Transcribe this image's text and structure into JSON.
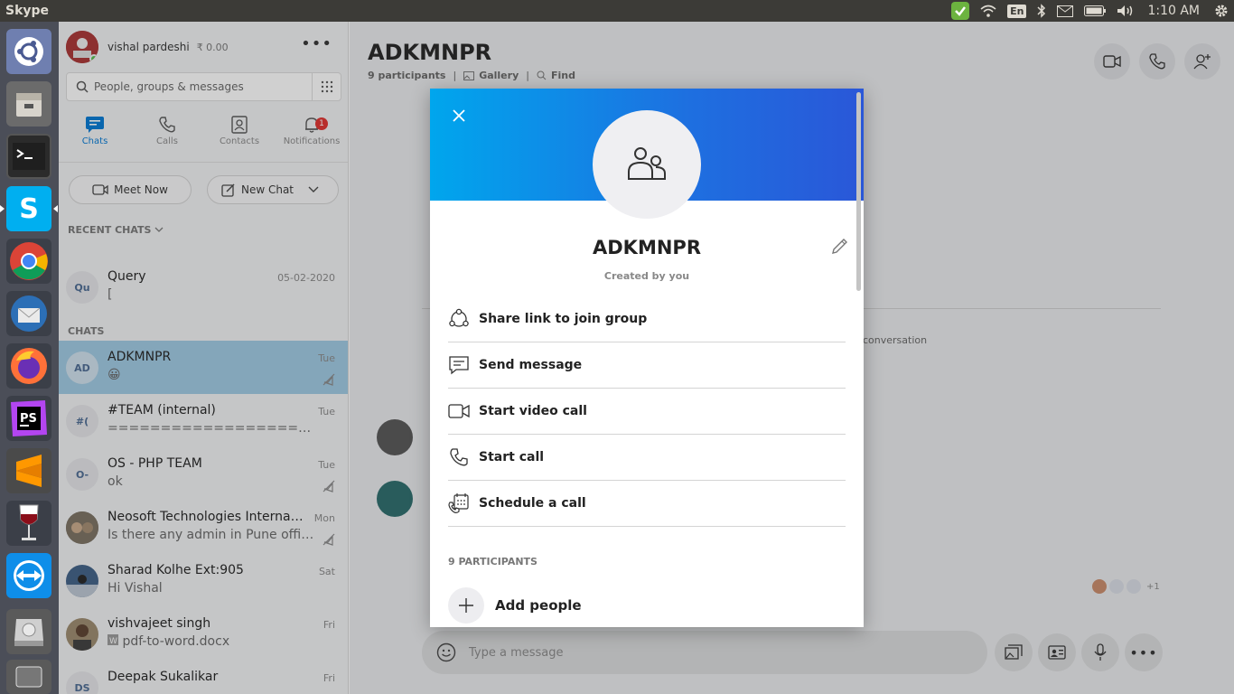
{
  "topbar": {
    "app_title": "Skype",
    "keyboard": "En",
    "clock": "1:10 AM"
  },
  "launcher": {
    "apps": [
      "ubuntu-dash-icon",
      "files-icon",
      "terminal-icon",
      "skype-icon",
      "chrome-icon",
      "thunderbird-icon",
      "firefox-icon",
      "phpstorm-icon",
      "sublime-text-icon",
      "wine-icon",
      "teamviewer-icon",
      "disk-icon",
      "drive-icon"
    ]
  },
  "profile": {
    "name": "vishal pardeshi",
    "credit": "₹ 0.00"
  },
  "search": {
    "placeholder": "People, groups & messages"
  },
  "nav": {
    "chats": "Chats",
    "calls": "Calls",
    "contacts": "Contacts",
    "notifications": "Notifications",
    "notification_count": "1"
  },
  "actions": {
    "meet_now": "Meet Now",
    "new_chat": "New Chat"
  },
  "sections": {
    "recent": "RECENT CHATS",
    "chats": "CHATS"
  },
  "recent_chats": [
    {
      "initials": "Qu",
      "name": "Query",
      "preview": "[",
      "date": "05-02-2020"
    }
  ],
  "chats": [
    {
      "initials": "AD",
      "name": "ADKMNPR",
      "preview": "😀",
      "date": "Tue"
    },
    {
      "initials": "#(",
      "name": "#TEAM (internal)",
      "preview": "======================....",
      "date": "Tue"
    },
    {
      "initials": "O-",
      "name": "OS - PHP TEAM",
      "preview": "ok",
      "date": "Tue"
    },
    {
      "initials": "",
      "name": "Neosoft Technologies Internati...",
      "preview": "Is there any admin in Pune office?",
      "date": "Mon"
    },
    {
      "initials": "",
      "name": "Sharad Kolhe Ext:905",
      "preview": "Hi Vishal",
      "date": "Sat"
    },
    {
      "initials": "",
      "name": "vishvajeet singh",
      "preview": "pdf-to-word.docx",
      "date": "Fri"
    },
    {
      "initials": "DS",
      "name": "Deepak Sukalikar",
      "preview": "",
      "date": "Fri"
    }
  ],
  "conversation": {
    "title": "ADKMNPR",
    "participants": "9 participants",
    "gallery": "Gallery",
    "find": "Find",
    "composer_placeholder": "Type a message",
    "bg_text_conversation": "conversation",
    "participant_extra": "+1"
  },
  "modal": {
    "group_name": "ADKMNPR",
    "created_by": "Created by you",
    "items": [
      {
        "label": "Share link to join group",
        "icon": "share-link-icon"
      },
      {
        "label": "Send message",
        "icon": "message-icon"
      },
      {
        "label": "Start video call",
        "icon": "video-camera-icon"
      },
      {
        "label": "Start call",
        "icon": "phone-icon"
      },
      {
        "label": "Schedule a call",
        "icon": "schedule-call-icon"
      }
    ],
    "participants_label": "9 PARTICIPANTS",
    "add_people": "Add people"
  },
  "colors": {
    "accent": "#0078d4",
    "banner_start": "#00a6ed",
    "banner_end": "#2a57d8",
    "selected_chat": "#9ec9e3",
    "badge": "#e0302d"
  }
}
